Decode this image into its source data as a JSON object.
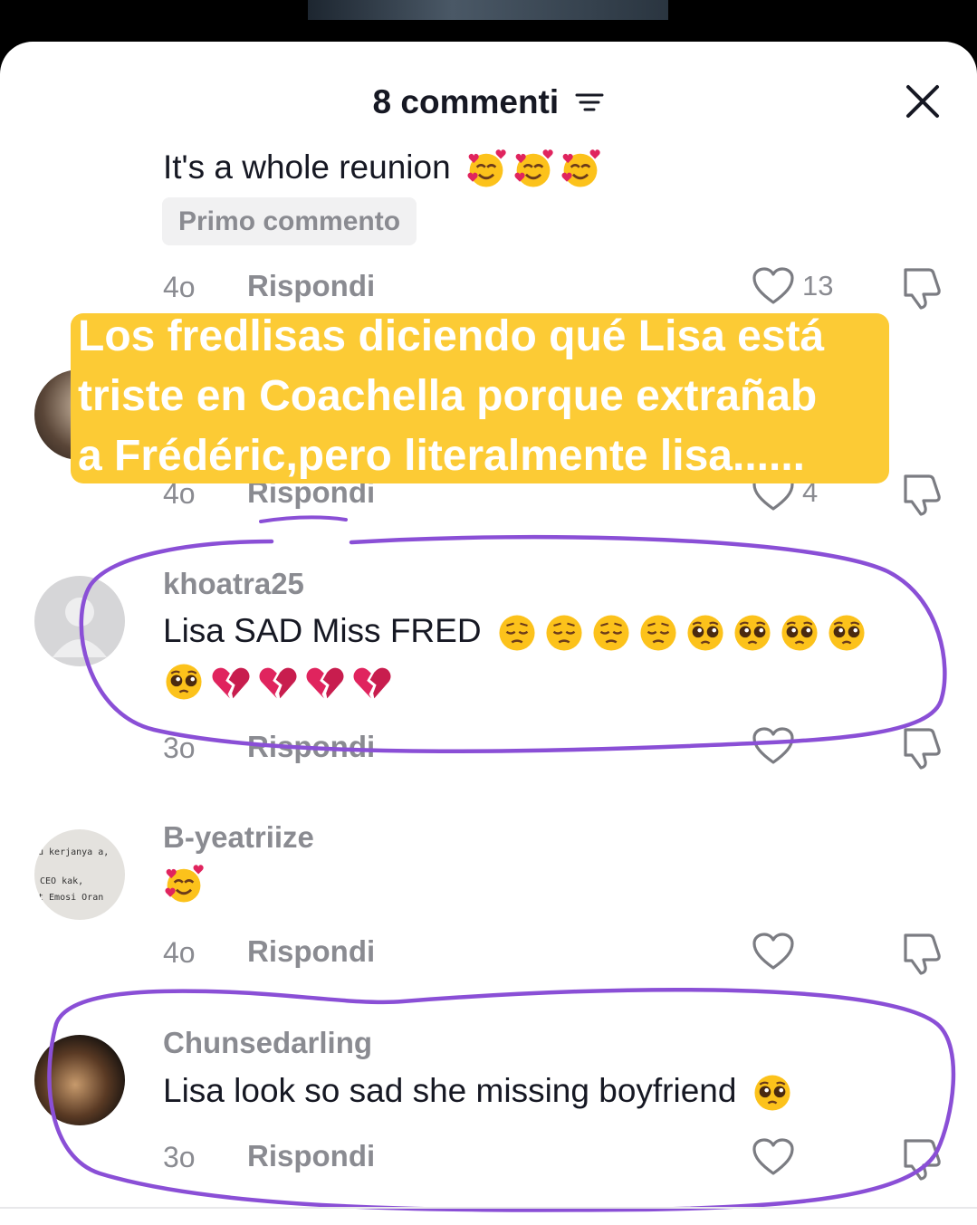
{
  "header": {
    "title": "8 commenti"
  },
  "comments": [
    {
      "text": "It's a whole reunion",
      "emojis": [
        "smiling-hearts",
        "smiling-hearts",
        "smiling-hearts"
      ],
      "badge": "Primo commento",
      "time": "4o",
      "reply": "Rispondi",
      "likes": "13"
    },
    {
      "time": "4o",
      "reply": "Rispondi",
      "likes": "4"
    },
    {
      "username": "khoatra25",
      "text": "Lisa SAD Miss FRED",
      "emojis": [
        "pensive",
        "pensive",
        "pensive",
        "pensive",
        "pleading",
        "pleading",
        "pleading",
        "pleading"
      ],
      "emojis_line2": [
        "pleading",
        "broken-heart",
        "broken-heart",
        "broken-heart",
        "broken-heart"
      ],
      "time": "3o",
      "reply": "Rispondi"
    },
    {
      "username": "B-yeatriize",
      "emojis": [
        "smiling-hearts"
      ],
      "avatar_text": [
        "u kerjanya a,",
        "CEO kak,",
        "t Emosi Oran"
      ],
      "time": "4o",
      "reply": "Rispondi"
    },
    {
      "username": "Chunsedarling",
      "text": "Lisa look so sad she missing boyfriend",
      "emojis": [
        "pleading"
      ],
      "time": "3o",
      "reply": "Rispondi"
    }
  ],
  "overlay": {
    "lines": [
      "Los fredlisas diciendo qué Lisa está",
      " triste en Coachella porque extrañab",
      "a Frédéric,pero literalmente lisa......"
    ]
  },
  "colors": {
    "overlay_bg": "#fccb35",
    "annotation": "#8a4fd6",
    "muted": "#8a8b91",
    "text": "#161823"
  }
}
